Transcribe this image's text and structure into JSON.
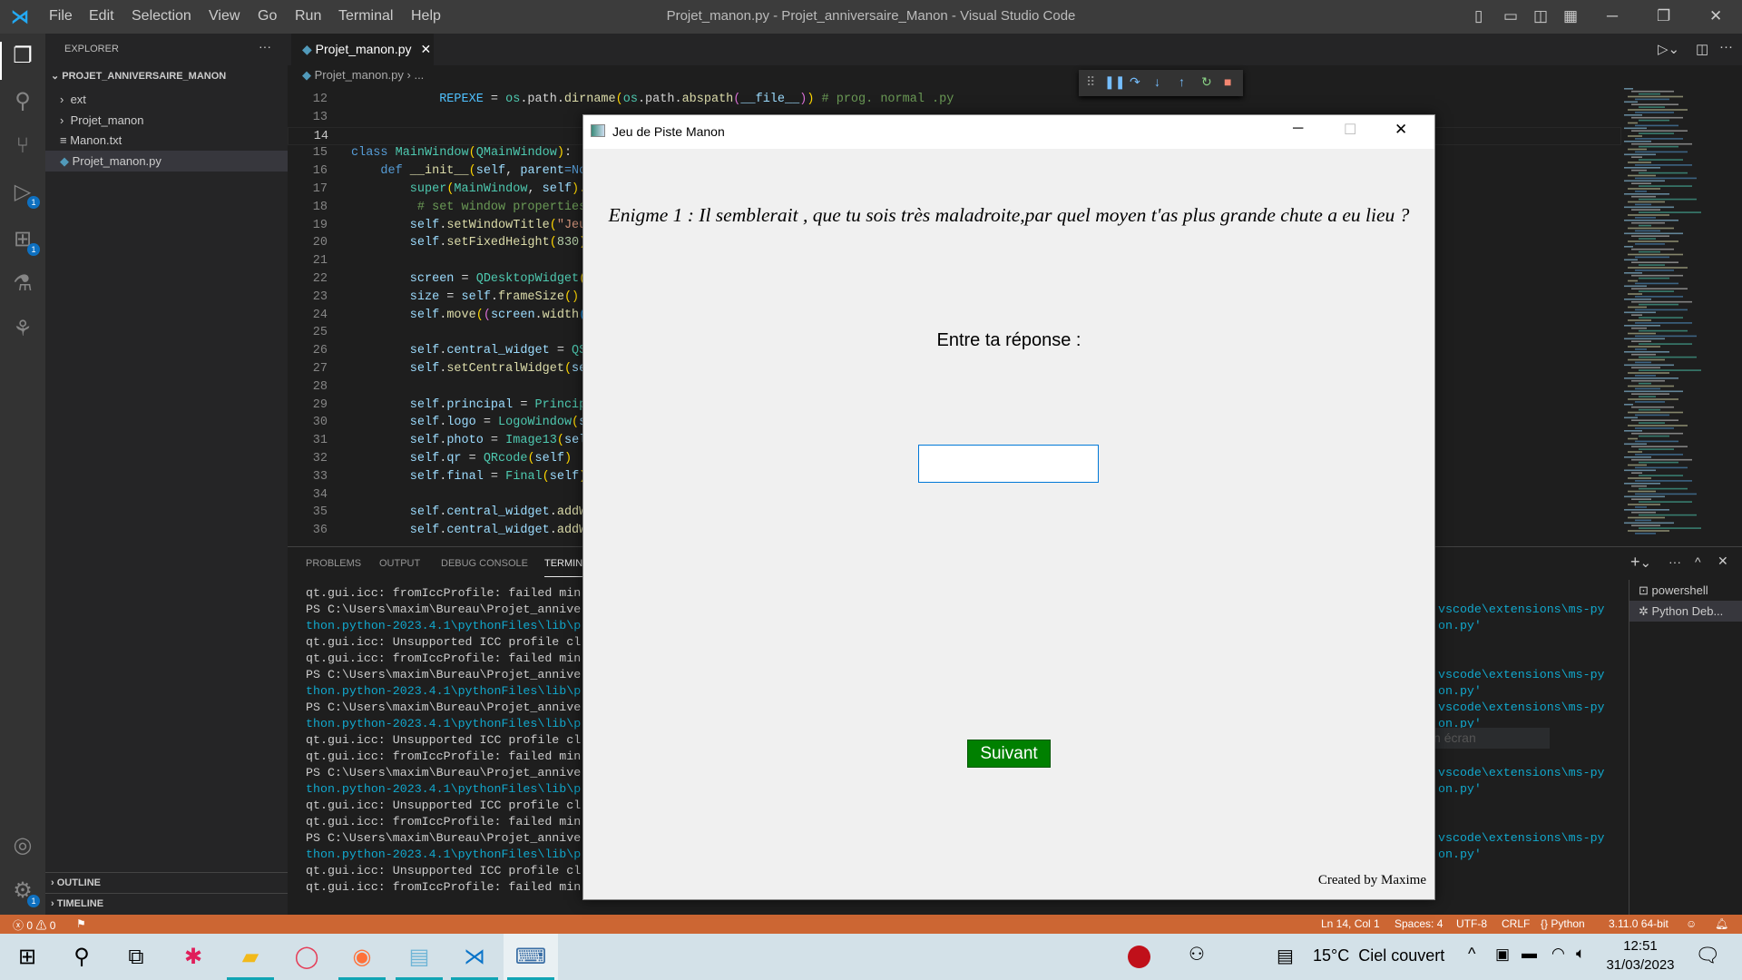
{
  "menubar": {
    "items": [
      "File",
      "Edit",
      "Selection",
      "View",
      "Go",
      "Run",
      "Terminal",
      "Help"
    ],
    "title": "Projet_manon.py - Projet_anniversaire_Manon - Visual Studio Code"
  },
  "activity": {
    "badges": {
      "run": "1",
      "extensions": "1",
      "settings": "1"
    }
  },
  "sidebar": {
    "header": "EXPLORER",
    "more": "···",
    "project": "PROJET_ANNIVERSAIRE_MANON",
    "items": [
      {
        "label": "ext",
        "type": "folder"
      },
      {
        "label": "Projet_manon",
        "type": "folder"
      },
      {
        "label": "Manon.txt",
        "type": "file"
      },
      {
        "label": "Projet_manon.py",
        "type": "python",
        "selected": true
      }
    ],
    "outline": "OUTLINE",
    "timeline": "TIMELINE"
  },
  "editor": {
    "tab": "Projet_manon.py",
    "breadcrumb": "Projet_manon.py",
    "breadcrumb_more": "...",
    "current_line": 14,
    "lines": [
      {
        "n": 12,
        "i": 3,
        "t": [
          [
            "REPEXE",
            "#4fc1ff"
          ],
          [
            " = ",
            "#d4d4d4"
          ],
          [
            "os",
            "#4ec9b0"
          ],
          [
            ".path.",
            "#d4d4d4"
          ],
          [
            "dirname",
            "#dcdcaa"
          ],
          [
            "(",
            "#ffd700"
          ],
          [
            "os",
            "#4ec9b0"
          ],
          [
            ".path.",
            "#d4d4d4"
          ],
          [
            "abspath",
            "#dcdcaa"
          ],
          [
            "(",
            "#da70d6"
          ],
          [
            "__file__",
            "#9cdcfe"
          ],
          [
            ")",
            "#da70d6"
          ],
          [
            ")",
            "#ffd700"
          ],
          [
            " # prog. normal .py",
            "#6a9955"
          ]
        ]
      },
      {
        "n": 13,
        "i": 0,
        "t": []
      },
      {
        "n": 14,
        "i": 0,
        "t": []
      },
      {
        "n": 15,
        "i": 0,
        "t": [
          [
            "class",
            "#569cd6"
          ],
          [
            " MainWindow",
            "#4ec9b0"
          ],
          [
            "(",
            "#ffd700"
          ],
          [
            "QMainWindow",
            "#4ec9b0"
          ],
          [
            ")",
            "#ffd700"
          ],
          [
            ":",
            "#d4d4d4"
          ]
        ]
      },
      {
        "n": 16,
        "i": 1,
        "t": [
          [
            "def",
            "#569cd6"
          ],
          [
            " __init__",
            "#dcdcaa"
          ],
          [
            "(",
            "#ffd700"
          ],
          [
            "self",
            "#9cdcfe"
          ],
          [
            ", ",
            "#d4d4d4"
          ],
          [
            "parent",
            "#9cdcfe"
          ],
          [
            "=No",
            "#569cd6"
          ]
        ]
      },
      {
        "n": 17,
        "i": 2,
        "t": [
          [
            "super",
            "#4ec9b0"
          ],
          [
            "(",
            "#ffd700"
          ],
          [
            "MainWindow",
            "#4ec9b0"
          ],
          [
            ", ",
            "#d4d4d4"
          ],
          [
            "self",
            "#9cdcfe"
          ],
          [
            ").",
            "#ffd700"
          ]
        ]
      },
      {
        "n": 18,
        "i": 2,
        "t": [
          [
            " # set window properties",
            "#6a9955"
          ]
        ]
      },
      {
        "n": 19,
        "i": 2,
        "t": [
          [
            "self",
            "#9cdcfe"
          ],
          [
            ".",
            "#d4d4d4"
          ],
          [
            "setWindowTitle",
            "#dcdcaa"
          ],
          [
            "(",
            "#ffd700"
          ],
          [
            "\"Jeu",
            "#ce9178"
          ]
        ]
      },
      {
        "n": 20,
        "i": 2,
        "t": [
          [
            "self",
            "#9cdcfe"
          ],
          [
            ".",
            "#d4d4d4"
          ],
          [
            "setFixedHeight",
            "#dcdcaa"
          ],
          [
            "(",
            "#ffd700"
          ],
          [
            "830",
            "#b5cea8"
          ],
          [
            ")",
            "#ffd700"
          ]
        ]
      },
      {
        "n": 21,
        "i": 0,
        "t": []
      },
      {
        "n": 22,
        "i": 2,
        "t": [
          [
            "screen",
            "#9cdcfe"
          ],
          [
            " = ",
            "#d4d4d4"
          ],
          [
            "QDesktopWidget",
            "#4ec9b0"
          ],
          [
            "(",
            "#ffd700"
          ]
        ]
      },
      {
        "n": 23,
        "i": 2,
        "t": [
          [
            "size",
            "#9cdcfe"
          ],
          [
            " = ",
            "#d4d4d4"
          ],
          [
            "self",
            "#9cdcfe"
          ],
          [
            ".",
            "#d4d4d4"
          ],
          [
            "frameSize",
            "#dcdcaa"
          ],
          [
            "()",
            "#ffd700"
          ]
        ]
      },
      {
        "n": 24,
        "i": 2,
        "t": [
          [
            "self",
            "#9cdcfe"
          ],
          [
            ".",
            "#d4d4d4"
          ],
          [
            "move",
            "#dcdcaa"
          ],
          [
            "(",
            "#ffd700"
          ],
          [
            "(",
            "#da70d6"
          ],
          [
            "screen",
            "#9cdcfe"
          ],
          [
            ".",
            "#d4d4d4"
          ],
          [
            "width",
            "#dcdcaa"
          ],
          [
            "(",
            "#179fff"
          ]
        ]
      },
      {
        "n": 25,
        "i": 0,
        "t": []
      },
      {
        "n": 26,
        "i": 2,
        "t": [
          [
            "self",
            "#9cdcfe"
          ],
          [
            ".",
            "#d4d4d4"
          ],
          [
            "central_widget",
            "#9cdcfe"
          ],
          [
            " = ",
            "#d4d4d4"
          ],
          [
            "QS",
            "#4ec9b0"
          ]
        ]
      },
      {
        "n": 27,
        "i": 2,
        "t": [
          [
            "self",
            "#9cdcfe"
          ],
          [
            ".",
            "#d4d4d4"
          ],
          [
            "setCentralWidget",
            "#dcdcaa"
          ],
          [
            "(",
            "#ffd700"
          ],
          [
            "se",
            "#9cdcfe"
          ]
        ]
      },
      {
        "n": 28,
        "i": 0,
        "t": []
      },
      {
        "n": 29,
        "i": 2,
        "t": [
          [
            "self",
            "#9cdcfe"
          ],
          [
            ".",
            "#d4d4d4"
          ],
          [
            "principal",
            "#9cdcfe"
          ],
          [
            " = ",
            "#d4d4d4"
          ],
          [
            "Princip",
            "#4ec9b0"
          ]
        ]
      },
      {
        "n": 30,
        "i": 2,
        "t": [
          [
            "self",
            "#9cdcfe"
          ],
          [
            ".",
            "#d4d4d4"
          ],
          [
            "logo",
            "#9cdcfe"
          ],
          [
            " = ",
            "#d4d4d4"
          ],
          [
            "LogoWindow",
            "#4ec9b0"
          ],
          [
            "(",
            "#ffd700"
          ],
          [
            "s",
            "#9cdcfe"
          ]
        ]
      },
      {
        "n": 31,
        "i": 2,
        "t": [
          [
            "self",
            "#9cdcfe"
          ],
          [
            ".",
            "#d4d4d4"
          ],
          [
            "photo",
            "#9cdcfe"
          ],
          [
            " = ",
            "#d4d4d4"
          ],
          [
            "Image13",
            "#4ec9b0"
          ],
          [
            "(",
            "#ffd700"
          ],
          [
            "sel",
            "#9cdcfe"
          ]
        ]
      },
      {
        "n": 32,
        "i": 2,
        "t": [
          [
            "self",
            "#9cdcfe"
          ],
          [
            ".",
            "#d4d4d4"
          ],
          [
            "qr",
            "#9cdcfe"
          ],
          [
            " = ",
            "#d4d4d4"
          ],
          [
            "QRcode",
            "#4ec9b0"
          ],
          [
            "(",
            "#ffd700"
          ],
          [
            "self",
            "#9cdcfe"
          ],
          [
            ")",
            "#ffd700"
          ]
        ]
      },
      {
        "n": 33,
        "i": 2,
        "t": [
          [
            "self",
            "#9cdcfe"
          ],
          [
            ".",
            "#d4d4d4"
          ],
          [
            "final",
            "#9cdcfe"
          ],
          [
            " = ",
            "#d4d4d4"
          ],
          [
            "Final",
            "#4ec9b0"
          ],
          [
            "(",
            "#ffd700"
          ],
          [
            "self",
            "#9cdcfe"
          ],
          [
            ")",
            "#ffd700"
          ]
        ]
      },
      {
        "n": 34,
        "i": 0,
        "t": []
      },
      {
        "n": 35,
        "i": 2,
        "t": [
          [
            "self",
            "#9cdcfe"
          ],
          [
            ".",
            "#d4d4d4"
          ],
          [
            "central_widget",
            "#9cdcfe"
          ],
          [
            ".",
            "#d4d4d4"
          ],
          [
            "addW",
            "#dcdcaa"
          ]
        ]
      },
      {
        "n": 36,
        "i": 2,
        "t": [
          [
            "self",
            "#9cdcfe"
          ],
          [
            ".",
            "#d4d4d4"
          ],
          [
            "central_widget",
            "#9cdcfe"
          ],
          [
            ".",
            "#d4d4d4"
          ],
          [
            "addW",
            "#dcdcaa"
          ]
        ]
      }
    ]
  },
  "panel": {
    "tabs": [
      "PROBLEMS",
      "OUTPUT",
      "DEBUG CONSOLE",
      "TERMINAL"
    ],
    "active_tab": "TERMINAL",
    "terminals": [
      "powershell",
      "Python Deb..."
    ],
    "lines": [
      {
        "l": "qt.gui.icc: fromIccProfile: failed min",
        "c": "#cccccc"
      },
      {
        "l": "PS C:\\Users\\maxim\\Bureau\\Projet_annive",
        "c": "#cccccc",
        "r": "vscode\\extensions\\ms-py"
      },
      {
        "l": "thon.python-2023.4.1\\pythonFiles\\lib\\p",
        "c": "#11a8cd",
        "r": "on.py'"
      },
      {
        "l": "qt.gui.icc: Unsupported ICC profile cl",
        "c": "#cccccc"
      },
      {
        "l": "qt.gui.icc: fromIccProfile: failed min",
        "c": "#cccccc"
      },
      {
        "l": "PS C:\\Users\\maxim\\Bureau\\Projet_annive",
        "c": "#cccccc",
        "r": "vscode\\extensions\\ms-py"
      },
      {
        "l": "thon.python-2023.4.1\\pythonFiles\\lib\\p",
        "c": "#11a8cd",
        "r": "on.py'"
      },
      {
        "l": "PS C:\\Users\\maxim\\Bureau\\Projet_annive",
        "c": "#cccccc",
        "r": "vscode\\extensions\\ms-py"
      },
      {
        "l": "thon.python-2023.4.1\\pythonFiles\\lib\\p",
        "c": "#11a8cd",
        "r": "on.py'"
      },
      {
        "l": "qt.gui.icc: Unsupported ICC profile cl",
        "c": "#cccccc"
      },
      {
        "l": "qt.gui.icc: fromIccProfile: failed min",
        "c": "#cccccc"
      },
      {
        "l": "PS C:\\Users\\maxim\\Bureau\\Projet_annive",
        "c": "#cccccc",
        "r": "vscode\\extensions\\ms-py"
      },
      {
        "l": "thon.python-2023.4.1\\pythonFiles\\lib\\p",
        "c": "#11a8cd",
        "r": "on.py'"
      },
      {
        "l": "qt.gui.icc: Unsupported ICC profile cl",
        "c": "#cccccc"
      },
      {
        "l": "qt.gui.icc: fromIccProfile: failed min",
        "c": "#cccccc"
      },
      {
        "l": "PS C:\\Users\\maxim\\Bureau\\Projet_annive",
        "c": "#cccccc",
        "r": "vscode\\extensions\\ms-py"
      },
      {
        "l": "thon.python-2023.4.1\\pythonFiles\\lib\\p",
        "c": "#11a8cd",
        "r": "on.py'"
      },
      {
        "l": "qt.gui.icc: Unsupported ICC profile cl",
        "c": "#cccccc"
      },
      {
        "l": "qt.gui.icc: fromIccProfile: failed min",
        "c": "#cccccc"
      }
    ],
    "tooltip": "Capture Plein écran"
  },
  "statusbar": {
    "errors": "0",
    "warnings": "0",
    "position": "Ln 14, Col 1",
    "spaces": "Spaces: 4",
    "encoding": "UTF-8",
    "eol": "CRLF",
    "language": "Python",
    "interpreter": "3.11.0 64-bit",
    "color": "#cc6633"
  },
  "app": {
    "title": "Jeu de Piste Manon",
    "question": "Enigme 1 : Il semblerait , que tu sois très maladroite,par quel moyen t'as plus grande chute a eu lieu ?",
    "prompt": "Entre ta réponse :",
    "answer": "",
    "next_button": "Suivant",
    "next_color": "#008000",
    "credit": "Created by Maxime"
  },
  "taskbar": {
    "weather": "15°C  Ciel couvert",
    "time": "12:51",
    "date": "31/03/2023"
  }
}
